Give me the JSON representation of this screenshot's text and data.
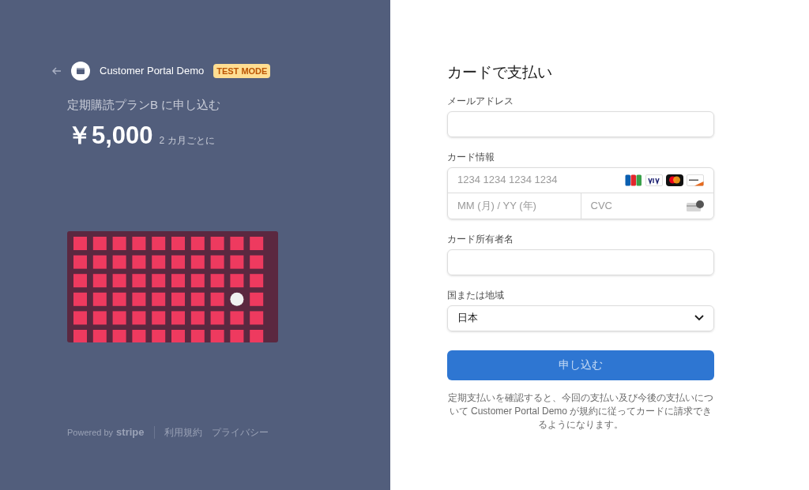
{
  "merchant": {
    "name": "Customer Portal Demo",
    "badge": "TEST MODE"
  },
  "product": {
    "title": "定期購読プランB に申し込む",
    "price": "￥5,000",
    "interval": "2 カ月ごとに"
  },
  "footer": {
    "powered": "Powered by",
    "brand": "stripe",
    "links": [
      "利用規約",
      "プライバシー"
    ]
  },
  "form": {
    "title": "カードで支払い",
    "email": {
      "label": "メールアドレス"
    },
    "card": {
      "label": "カード情報",
      "number_placeholder": "1234 1234 1234 1234",
      "expiry_placeholder": "MM (月) / YY (年)",
      "cvc_placeholder": "CVC",
      "brands": [
        {
          "kind": "jcb"
        },
        {
          "kind": "visa"
        },
        {
          "kind": "mastercard"
        },
        {
          "kind": "discover"
        }
      ]
    },
    "holder": {
      "label": "カード所有者名"
    },
    "country": {
      "label": "国または地域",
      "value": "日本"
    },
    "submit": "申し込む",
    "terms": "定期支払いを確認すると、今回の支払い及び今後の支払いについて Customer Portal Demo が規約に従ってカードに請求できるようになります。"
  }
}
